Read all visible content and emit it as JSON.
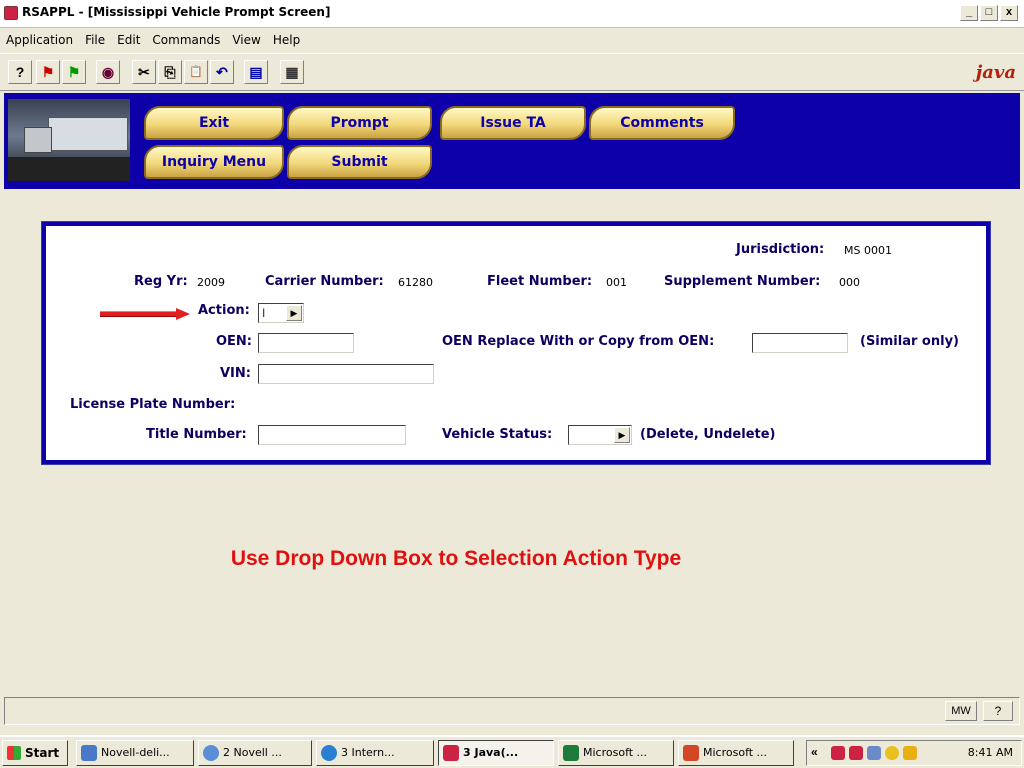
{
  "window": {
    "title": "RSAPPL - [Mississippi Vehicle Prompt Screen]",
    "min": "_",
    "max": "□",
    "close": "x"
  },
  "menubar": [
    "Application",
    "File",
    "Edit",
    "Commands",
    "View",
    "Help"
  ],
  "toolbar": {
    "icons": [
      "help-icon",
      "flag-icon",
      "flag-alert-icon",
      "view-icon",
      "cut-icon",
      "copy-icon",
      "paste-icon",
      "undo-icon",
      "print-icon",
      "calculator-icon"
    ],
    "glyphs": [
      "?",
      "⚑",
      "⚑",
      "◉",
      "✂",
      "⎘",
      "📋",
      "↶",
      "▤",
      "▦"
    ],
    "logo": "java"
  },
  "header_buttons": {
    "exit": "Exit",
    "prompt": "Prompt",
    "issue_ta": "Issue TA",
    "comments": "Comments",
    "inquiry_menu": "Inquiry Menu",
    "submit": "Submit"
  },
  "form": {
    "jurisdiction_label": "Jurisdiction:",
    "jurisdiction_value": "MS  0001",
    "reg_yr_label": "Reg Yr:",
    "reg_yr_value": "2009",
    "carrier_label": "Carrier Number:",
    "carrier_value": "61280",
    "fleet_label": "Fleet Number:",
    "fleet_value": "001",
    "supplement_label": "Supplement Number:",
    "supplement_value": "000",
    "action_label": "Action:",
    "action_value": "",
    "oen_label": "OEN:",
    "oen_value": "",
    "oen_replace_label": "OEN Replace With or  Copy from OEN:",
    "oen_replace_value": "",
    "similar_only": "(Similar only)",
    "vin_label": "VIN:",
    "vin_value": "",
    "plate_label": "License Plate Number:",
    "title_label": "Title Number:",
    "title_value": "",
    "vehicle_status_label": "Vehicle Status:",
    "vehicle_status_value": "",
    "vehicle_status_hint": "(Delete, Undelete)"
  },
  "instruction": "Use Drop Down Box to Selection Action Type",
  "statusbar": {
    "mw": "MW",
    "help": "?"
  },
  "taskbar": {
    "start": "Start",
    "tasks": [
      "Novell-deli...",
      "2 Novell ...",
      "3 Intern...",
      "3 Java(...",
      "Microsoft ...",
      "Microsoft ..."
    ],
    "clock": "8:41 AM"
  }
}
